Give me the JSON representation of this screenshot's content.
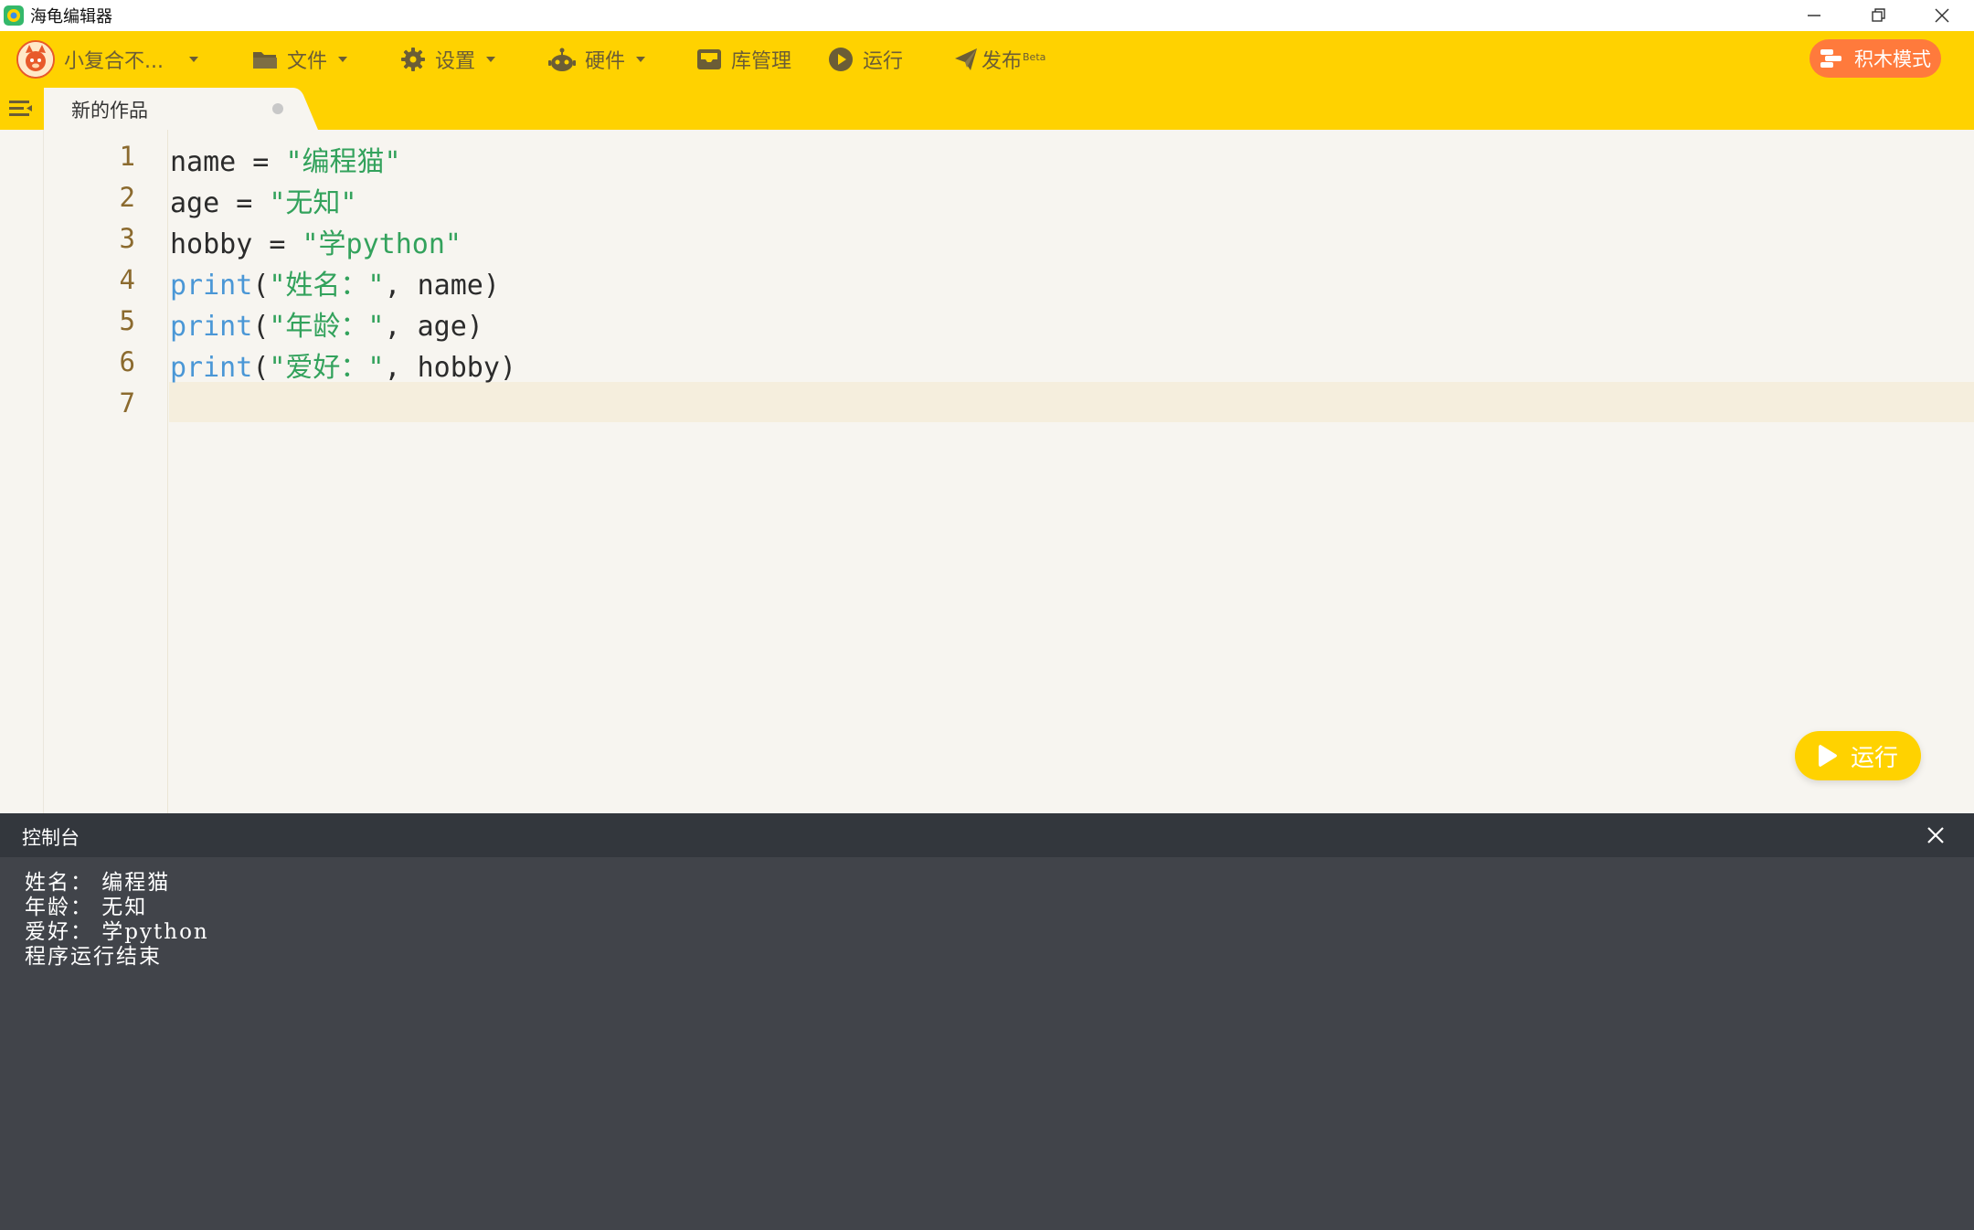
{
  "window": {
    "title": "海龟编辑器"
  },
  "toolbar": {
    "user_name": "小复合不...",
    "file": "文件",
    "settings": "设置",
    "hardware": "硬件",
    "library": "库管理",
    "run": "运行",
    "publish": "发布",
    "publish_badge": "Beta",
    "block_mode": "积木模式"
  },
  "tab": {
    "label": "新的作品"
  },
  "editor": {
    "line_numbers": [
      "1",
      "2",
      "3",
      "4",
      "5",
      "6",
      "7"
    ],
    "lines": [
      [
        {
          "t": "name = ",
          "c": "plain"
        },
        {
          "t": "\"编程猫\"",
          "c": "str"
        }
      ],
      [
        {
          "t": "age = ",
          "c": "plain"
        },
        {
          "t": "\"无知\"",
          "c": "str"
        }
      ],
      [
        {
          "t": "hobby = ",
          "c": "plain"
        },
        {
          "t": "\"学python\"",
          "c": "str"
        }
      ],
      [
        {
          "t": "print",
          "c": "kw"
        },
        {
          "t": "(",
          "c": "plain"
        },
        {
          "t": "\"姓名：\"",
          "c": "str"
        },
        {
          "t": ", name)",
          "c": "plain"
        }
      ],
      [
        {
          "t": "print",
          "c": "kw"
        },
        {
          "t": "(",
          "c": "plain"
        },
        {
          "t": "\"年龄：\"",
          "c": "str"
        },
        {
          "t": ", age)",
          "c": "plain"
        }
      ],
      [
        {
          "t": "print",
          "c": "kw"
        },
        {
          "t": "(",
          "c": "plain"
        },
        {
          "t": "\"爱好：\"",
          "c": "str"
        },
        {
          "t": ", hobby)",
          "c": "plain"
        }
      ],
      []
    ],
    "active_line": "7",
    "run_button": "运行"
  },
  "console": {
    "title": "控制台",
    "output": [
      "姓名： 编程猫",
      "年龄： 无知",
      "爱好： 学python",
      "程序运行结束"
    ]
  },
  "colors": {
    "accent_yellow": "#ffd200",
    "accent_orange": "#ff7a3c",
    "keyword": "#4a97d6",
    "string": "#33a25c",
    "console_bg": "#41444a"
  }
}
